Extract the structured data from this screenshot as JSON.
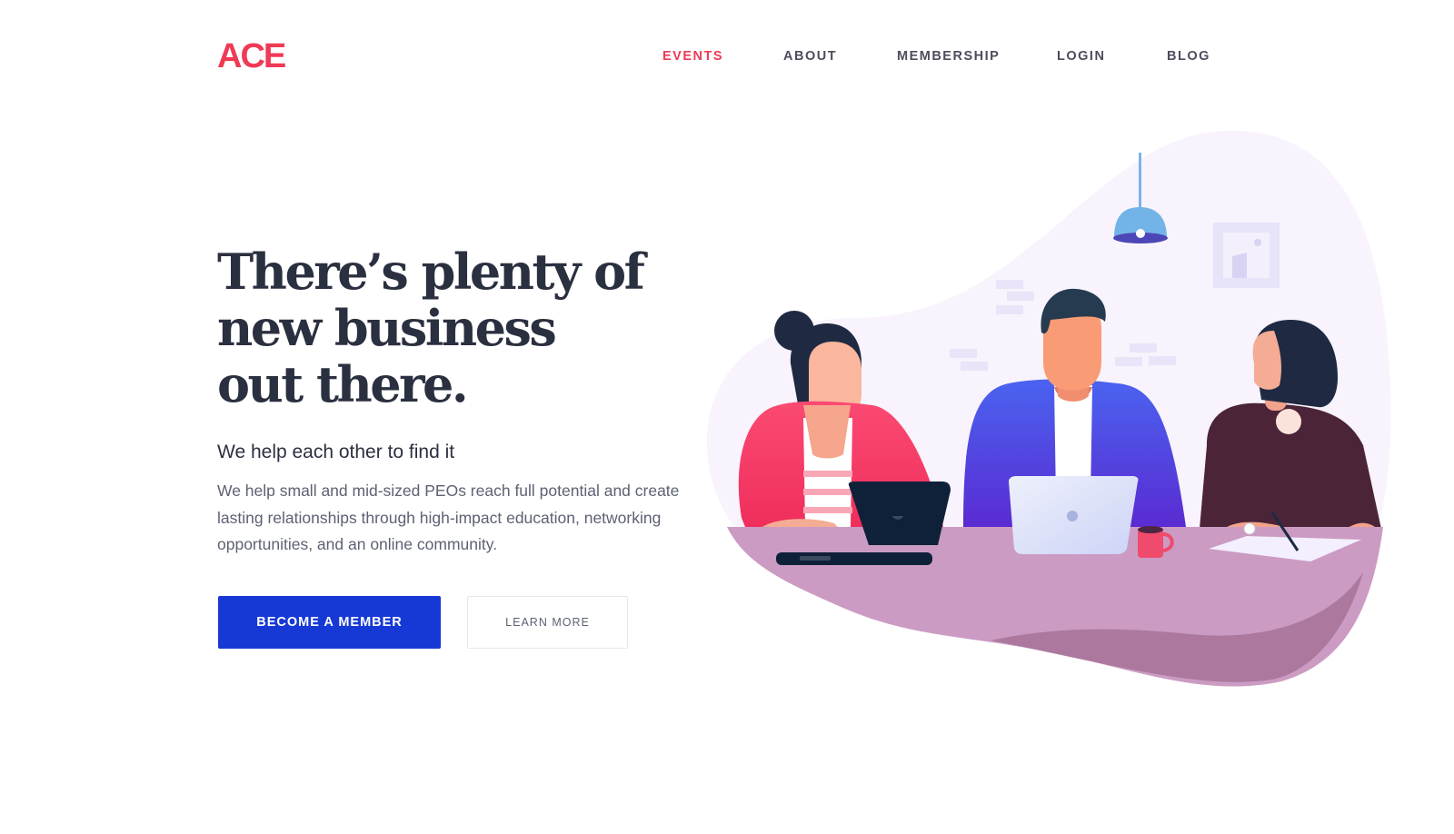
{
  "brand": {
    "logo_text": "ACE",
    "accent_color": "#ef3a55"
  },
  "nav": {
    "items": [
      {
        "label": "EVENTS",
        "active": true
      },
      {
        "label": "ABOUT",
        "active": false
      },
      {
        "label": "MEMBERSHIP",
        "active": false
      },
      {
        "label": "LOGIN",
        "active": false
      },
      {
        "label": "BLOG",
        "active": false
      }
    ]
  },
  "hero": {
    "title_lines": [
      "There’s plenty of",
      "new business",
      "out there."
    ],
    "subtitle": "We help each other to find it",
    "description": "We help small and mid-sized PEOs reach full potential and create lasting relationships through high-impact education, networking opportunities, and an online community.",
    "primary_button": "BECOME A MEMBER",
    "secondary_button": "LEARN MORE",
    "primary_color": "#1639d6"
  },
  "illustration": {
    "subject": "three-people-meeting-at-table",
    "icons": [
      "pendant-lamp-icon",
      "wall-picture-icon",
      "laptop-icon",
      "coffee-mug-icon",
      "notepad-icon",
      "pen-icon",
      "watch-icon"
    ]
  }
}
